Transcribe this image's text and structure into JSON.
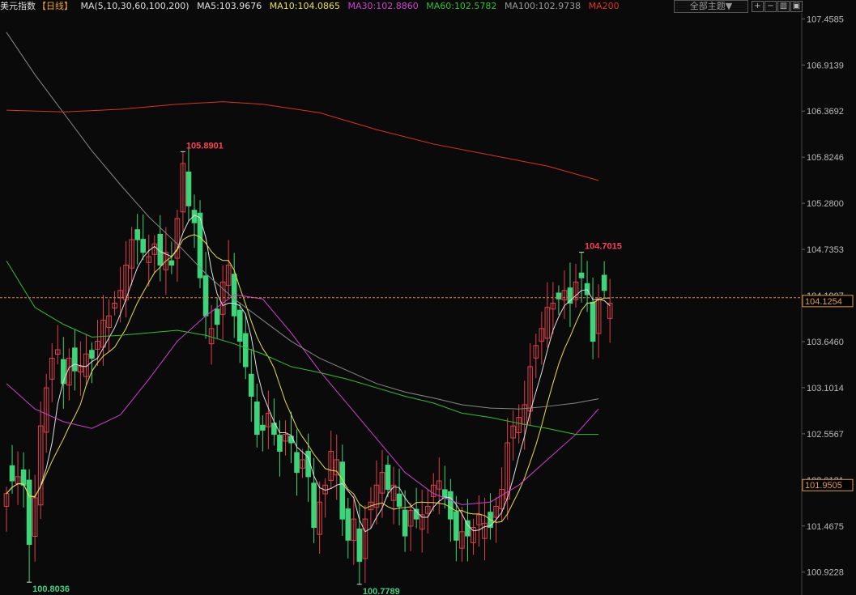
{
  "header": {
    "title": "美元指数",
    "period": "【日线】",
    "ma_params": "MA(5,10,30,60,100,200)",
    "ma5": "MA5:103.9676",
    "ma10": "MA10:104.0865",
    "ma30": "MA30:102.8860",
    "ma60": "MA60:102.5782",
    "ma100": "MA100:102.9738",
    "ma200": "MA200",
    "theme_button": "全部主题▼"
  },
  "colors": {
    "background": "#0a0a0a",
    "up": "#e0404a",
    "down": "#3ed47a",
    "ma5": "#e0e0e0",
    "ma10": "#e8e040",
    "ma30": "#d040d0",
    "ma60": "#30c030",
    "ma100": "#888888",
    "ma200": "#e03020",
    "price_line": "#e08040"
  },
  "chart_data": {
    "type": "candlestick",
    "title": "美元指数",
    "ylim": [
      100.7,
      107.5
    ],
    "y_ticks": [
      "107.4585",
      "106.9139",
      "106.3692",
      "105.8246",
      "105.2800",
      "104.7353",
      "104.1907",
      "103.6460",
      "103.1014",
      "102.5567",
      "102.0121",
      "101.4675",
      "100.9228"
    ],
    "current_price": "104.1254",
    "marker_price": "101.9505",
    "annotations": [
      {
        "label": "105.8901",
        "value": 105.8901,
        "index": 31
      },
      {
        "label": "104.7015",
        "value": 104.7015,
        "index": 101
      },
      {
        "label": "100.8036",
        "value": 100.8036,
        "index": 4
      },
      {
        "label": "100.7789",
        "value": 100.7789,
        "index": 62
      }
    ],
    "close": [
      101.85,
      102.0,
      102.05,
      101.95,
      101.25,
      101.8,
      102.65,
      103.1,
      103.45,
      103.55,
      103.15,
      103.45,
      103.3,
      103.35,
      103.5,
      103.45,
      103.65,
      103.9,
      103.95,
      104.1,
      104.25,
      104.55,
      104.85,
      104.85,
      104.7,
      104.65,
      104.8,
      104.55,
      104.7,
      104.55,
      105.1,
      105.75,
      105.25,
      105.05,
      104.4,
      103.95,
      103.8,
      103.85,
      104.35,
      104.55,
      103.95,
      103.65,
      103.35,
      103.0,
      102.55,
      102.6,
      102.8,
      102.55,
      102.35,
      102.55,
      102.45,
      102.1,
      102.25,
      102.05,
      101.45,
      101.75,
      101.95,
      102.35,
      102.25,
      101.55,
      101.3,
      101.55,
      101.05,
      101.55,
      101.75,
      101.95,
      102.1,
      101.9,
      101.95,
      101.7,
      101.35,
      101.65,
      101.55,
      101.6,
      101.7,
      101.95,
      102.0,
      101.8,
      101.55,
      101.3,
      101.4,
      101.35,
      101.45,
      101.6,
      101.5,
      101.45,
      101.7,
      101.9,
      102.45,
      102.65,
      102.75,
      102.9,
      103.35,
      103.6,
      103.8,
      104.05,
      104.1,
      104.15,
      104.25,
      104.1,
      104.35,
      104.4,
      104.2,
      103.65,
      104.15,
      104.25,
      104.1
    ]
  }
}
